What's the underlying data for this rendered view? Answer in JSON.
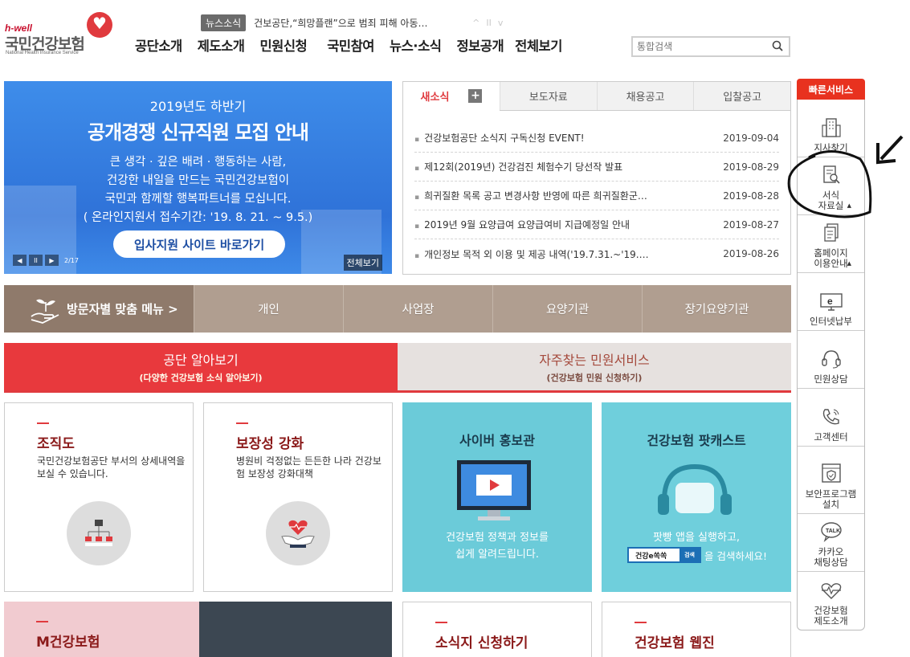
{
  "header": {
    "logo": {
      "hwell": "h-well",
      "name": "국민건강보험",
      "eng": "National Health Insurance Service"
    },
    "ticker": {
      "badge": "뉴스소식",
      "text": "건보공단,“희망플랜”으로 범죄 피해 아동…",
      "controls": [
        "^",
        "II",
        "v"
      ]
    },
    "gnb": [
      "공단소개",
      "제도소개",
      "민원신청",
      "국민참여",
      "뉴스·소식",
      "정보공개",
      "전체보기"
    ],
    "search": {
      "placeholder": "통합검색",
      "icon": "search-icon"
    }
  },
  "banner": {
    "line1": "2019년도 하반기",
    "line2": "공개경쟁 신규직원 모집 안내",
    "body": [
      "큰 생각 · 깊은 배려 · 행동하는 사람,",
      "건강한 내일을 만드는 국민건강보험이",
      "국민과 함께할 행복파트너를 모십니다.",
      "( 온라인지원서 접수기간: '19. 8. 21. ~ 9.5.)"
    ],
    "button": "입사지원 사이트 바로가기",
    "counter": "2/17",
    "all": "전체보기"
  },
  "board": {
    "tabs": [
      "새소식",
      "보도자료",
      "채용공고",
      "입찰공고"
    ],
    "plus": "+",
    "items": [
      {
        "title": "건강보험공단 소식지 구독신청 EVENT!",
        "date": "2019-09-04"
      },
      {
        "title": "제12회(2019년) 건강검진 체험수기 당선작 발표",
        "date": "2019-08-29"
      },
      {
        "title": "희귀질환 목록 공고 변경사항 반영에 따른 희귀질환군…",
        "date": "2019-08-28"
      },
      {
        "title": "2019년 9월 요양급여 요양급여비 지급예정일 안내",
        "date": "2019-08-27"
      },
      {
        "title": "개인정보 목적 외 이용 및 제공 내역('19.7.31.~'19.…",
        "date": "2019-08-26"
      }
    ]
  },
  "visitor": {
    "head": "방문자별 맞춤 메뉴 >",
    "items": [
      "개인",
      "사업장",
      "요양기관",
      "장기요양기관"
    ]
  },
  "section_tabs": [
    {
      "t1": "공단 알아보기",
      "t2": "(다양한 건강보험 소식 알아보기)"
    },
    {
      "t1": "자주찾는 민원서비스",
      "t2": "(건강보험 민원 신청하기)"
    }
  ],
  "cards": {
    "org": {
      "title": "조직도",
      "desc": "국민건강보험공단 부서의 상세내역을 보실 수 있습니다."
    },
    "cover": {
      "title": "보장성 강화",
      "desc": "병원비 걱정없는 든든한 나라 건강보험 보장성 강화대책"
    },
    "cyber": {
      "title": "사이버 홍보관",
      "body": [
        "건강보험 정책과 정보를",
        "쉽게 알려드립니다."
      ]
    },
    "podcast": {
      "title": "건강보험 팟캐스트",
      "body": "팟빵 앱을 실행하고,",
      "search_term": "건강e쏙쏙",
      "search_btn": "검색",
      "suffix": "을 검색하세요!"
    },
    "mhealth": {
      "title": "M건강보험"
    },
    "newsletter": {
      "title": "소식지 신청하기"
    },
    "webzine": {
      "title": "건강보험 웹진"
    }
  },
  "quick": {
    "header": "빠른서비스",
    "items": [
      {
        "label": "지사찾기",
        "icon": "building-icon"
      },
      {
        "label": "서식\n자료실",
        "icon": "document-search-icon"
      },
      {
        "label": "홈페이지\n이용안내",
        "icon": "documents-icon"
      },
      {
        "label": "인터넷납부",
        "icon": "monitor-e-icon"
      },
      {
        "label": "민원상담",
        "icon": "headset-icon"
      },
      {
        "label": "고객센터",
        "icon": "phone-icon"
      },
      {
        "label": "보안프로그램\n설치",
        "icon": "shield-window-icon"
      },
      {
        "label": "카카오\n채팅상담",
        "icon": "talk-bubble-icon"
      },
      {
        "label": "건강보험\n제도소개",
        "icon": "heart-pulse-icon"
      }
    ]
  },
  "colors": {
    "brand_red": "#e03a3e",
    "banner_blue": "#2f72d8",
    "visitor_brown": "#b09e90",
    "cyan": "#6bcbd9"
  }
}
